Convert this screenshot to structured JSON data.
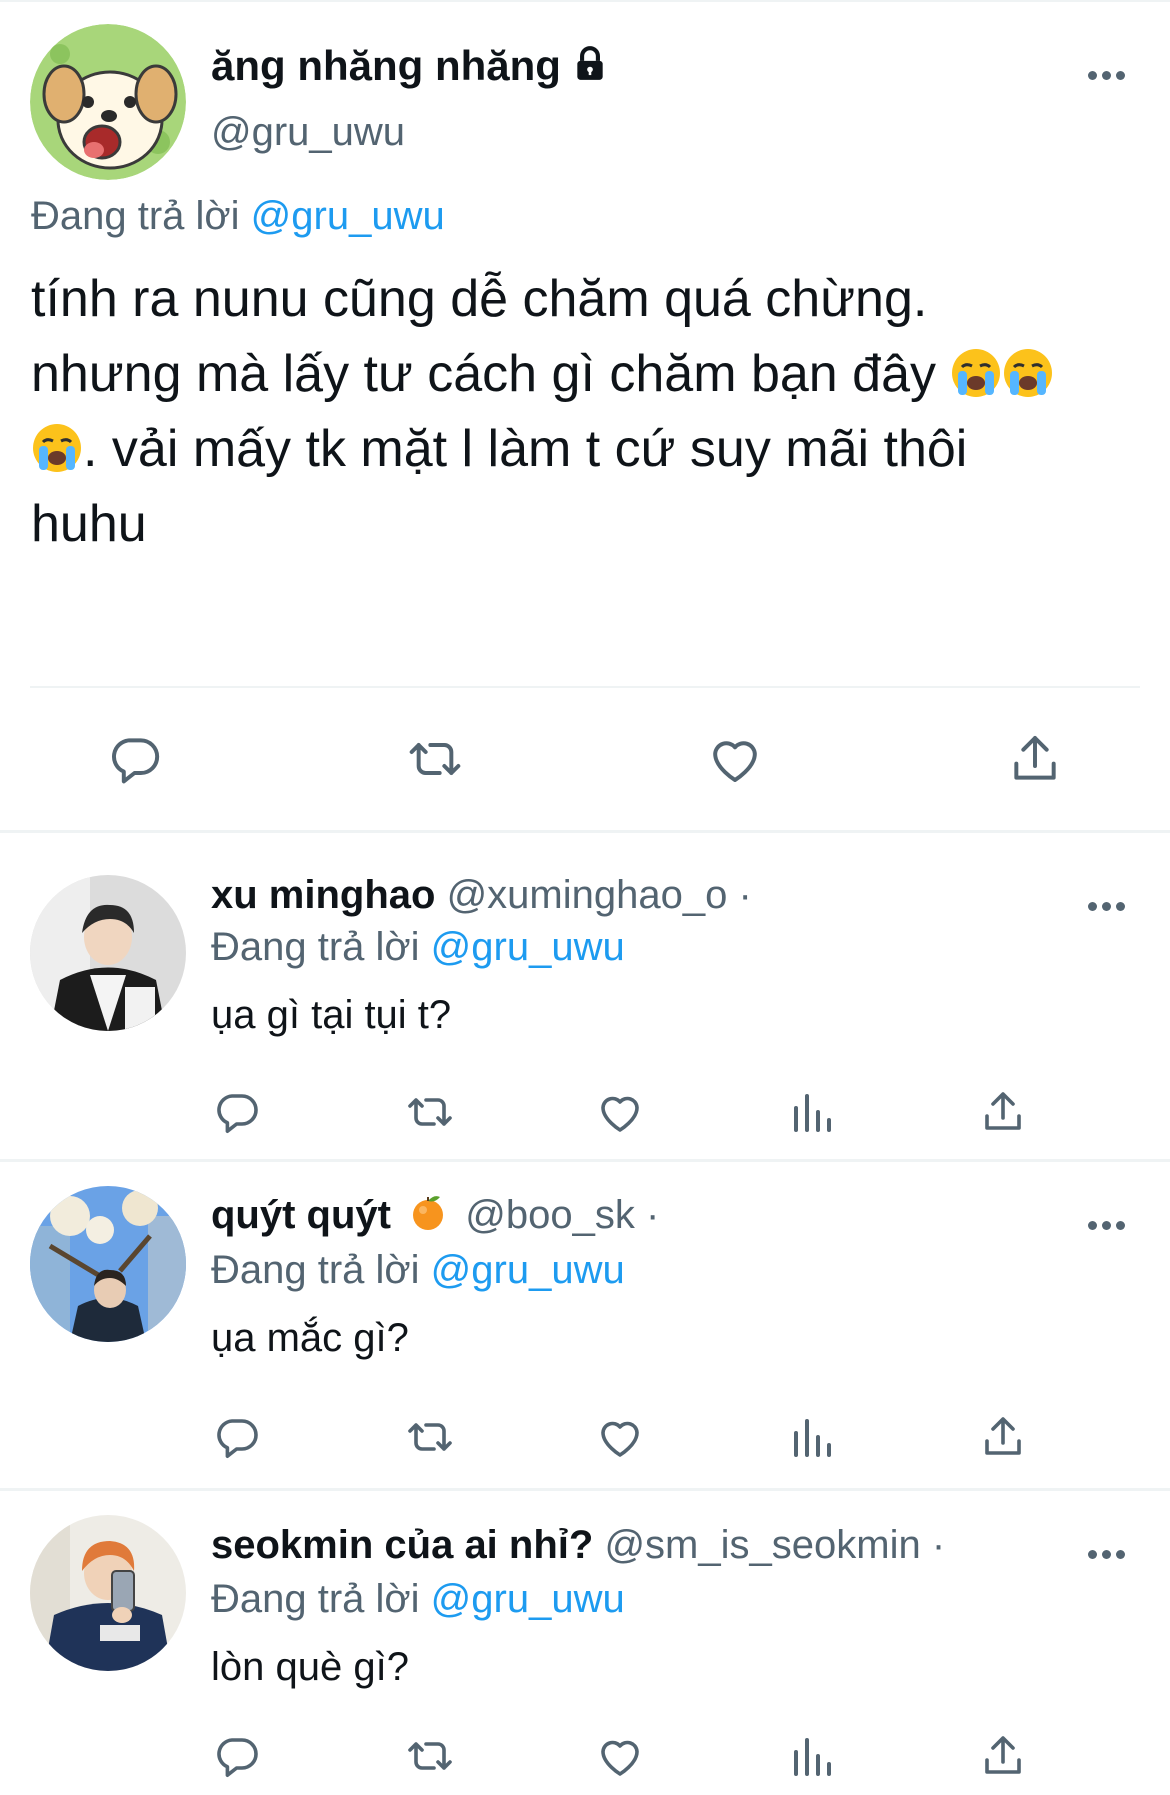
{
  "main_tweet": {
    "display_name": "ăng nhăng nhăng",
    "handle": "@gru_uwu",
    "replying_label": "Đang trả lời",
    "replying_to": "@gru_uwu",
    "text_line1": "tính ra nunu cũng dễ chăm quá chừng.",
    "text_line2": "nhưng mà lấy tư cách gì chăm bạn đây",
    "text_line3": ". vải mấy tk mặt l làm t cứ suy mãi thôi",
    "text_line4": "huhu",
    "icons": [
      "lock-icon",
      "loudly-crying-face-emoji",
      "more-icon"
    ],
    "actions": [
      "reply-icon",
      "retweet-icon",
      "like-icon",
      "share-icon"
    ]
  },
  "replies": [
    {
      "display_name": "xu minghao",
      "handle": "@xuminghao_o",
      "separator": "·",
      "replying_label": "Đang trả lời",
      "replying_to": "@gru_uwu",
      "text": "ụa gì tại tụi t?"
    },
    {
      "display_name": "quýt quýt",
      "name_emoji": "tangerine-emoji",
      "handle": "@boo_sk",
      "separator": "·",
      "replying_label": "Đang trả lời",
      "replying_to": "@gru_uwu",
      "text": "ụa mắc gì?"
    },
    {
      "display_name": "seokmin của ai nhỉ?",
      "handle": "@sm_is_seokmin",
      "separator": "·",
      "replying_label": "Đang trả lời",
      "replying_to": "@gru_uwu",
      "text": "lòn què gì?"
    }
  ],
  "reply_actions": [
    "reply-icon",
    "retweet-icon",
    "like-icon",
    "analytics-icon",
    "share-icon"
  ],
  "colors": {
    "text_primary": "#0f1419",
    "text_secondary": "#536471",
    "link": "#1d9bf0",
    "divider": "#eff3f4"
  }
}
